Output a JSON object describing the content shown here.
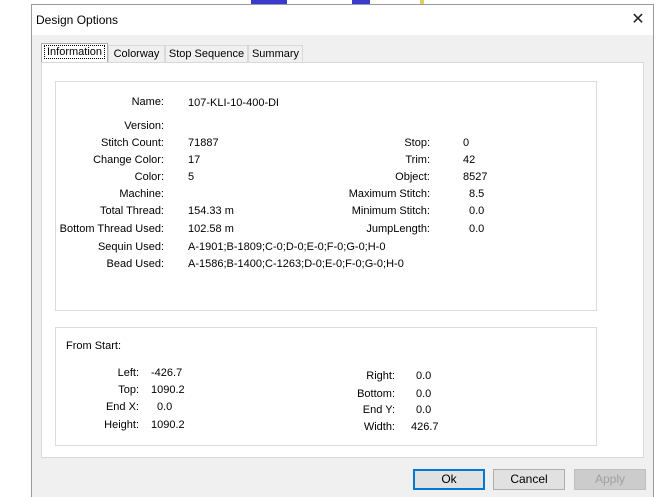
{
  "window": {
    "title": "Design Options",
    "close_glyph": "✕"
  },
  "tabs": [
    {
      "label": "Information",
      "active": true
    },
    {
      "label": "Colorway",
      "active": false
    },
    {
      "label": "Stop Sequence",
      "active": false
    },
    {
      "label": "Summary",
      "active": false
    }
  ],
  "info": {
    "name": {
      "label": "Name:",
      "value": "107-KLI-10-400-DH"
    },
    "version": {
      "label": "Version:",
      "value": ""
    },
    "stitch_count": {
      "label": "Stitch Count:",
      "value": "71887"
    },
    "change_color": {
      "label": "Change Color:",
      "value": "17"
    },
    "color": {
      "label": "Color:",
      "value": "5"
    },
    "machine": {
      "label": "Machine:",
      "value": ""
    },
    "total_thread": {
      "label": "Total Thread:",
      "value": "154.33 m"
    },
    "bottom_thread": {
      "label": "Bottom Thread Used:",
      "value": "102.58 m"
    },
    "sequin_used": {
      "label": "Sequin Used:",
      "value": "A-1901;B-1809;C-0;D-0;E-0;F-0;G-0;H-0"
    },
    "bead_used": {
      "label": "Bead Used:",
      "value": "A-1586;B-1400;C-1263;D-0;E-0;F-0;G-0;H-0"
    },
    "stop": {
      "label": "Stop:",
      "value": "0"
    },
    "trim": {
      "label": "Trim:",
      "value": "42"
    },
    "object": {
      "label": "Object:",
      "value": "8527"
    },
    "max_stitch": {
      "label": "Maximum Stitch:",
      "value": "8.5"
    },
    "min_stitch": {
      "label": "Minimum Stitch:",
      "value": "0.0"
    },
    "jump_length": {
      "label": "JumpLength:",
      "value": "0.0"
    }
  },
  "from_start": {
    "heading": "From Start:",
    "left": {
      "label": "Left:",
      "value": "-426.7"
    },
    "top": {
      "label": "Top:",
      "value": "1090.2"
    },
    "end_x": {
      "label": "End X:",
      "value": "0.0"
    },
    "height": {
      "label": "Height:",
      "value": "1090.2"
    },
    "right": {
      "label": "Right:",
      "value": "0.0"
    },
    "bottom": {
      "label": "Bottom:",
      "value": "0.0"
    },
    "end_y": {
      "label": "End Y:",
      "value": "0.0"
    },
    "width": {
      "label": "Width:",
      "value": "426.7"
    }
  },
  "buttons": {
    "ok": "Ok",
    "cancel": "Cancel",
    "apply": "Apply"
  }
}
